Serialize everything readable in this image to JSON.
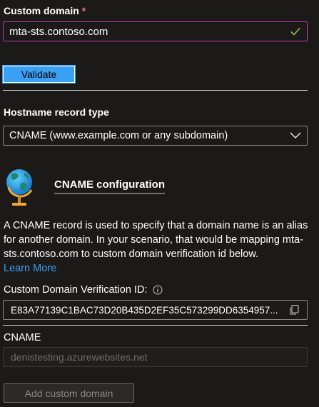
{
  "custom_domain": {
    "label": "Custom domain",
    "required_mark": "*",
    "value": "mta-sts.contoso.com"
  },
  "validate_button": {
    "label": "Validate"
  },
  "hostname_record": {
    "label": "Hostname record type",
    "selected": "CNAME (www.example.com or any subdomain)"
  },
  "cname_config": {
    "title": "CNAME configuration",
    "description": "A CNAME record is used to specify that a domain name is an alias for another domain. In your scenario, that would be mapping mta-sts.contoso.com to custom domain verification id below.",
    "learn_more": "Learn More"
  },
  "verification": {
    "label": "Custom Domain Verification ID:",
    "value": "E83A77139C1BAC73D20B435D2EF35C573299DD6354957..."
  },
  "cname": {
    "label": "CNAME",
    "placeholder": "denistesting.azurewebsites.net"
  },
  "add_button": {
    "label": "Add custom domain"
  },
  "colors": {
    "background": "#1b1a19",
    "accent": "#3aa0f3",
    "focus_border": "#c239b3",
    "success": "#92c353",
    "required": "#f1707b"
  }
}
